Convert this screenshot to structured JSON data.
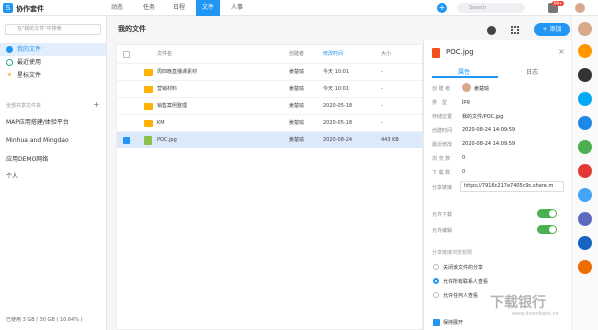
{
  "app": {
    "name": "协作套件",
    "logo_text": "S"
  },
  "nav": [
    "动态",
    "任务",
    "日程",
    "文件",
    "人事"
  ],
  "top": {
    "search_placeholder": "Search",
    "badge": "99+"
  },
  "sidebar": {
    "search_placeholder": "在\"我的文件\"中搜索",
    "items": [
      {
        "label": "我的文件"
      },
      {
        "label": "最近使用"
      },
      {
        "label": "星标文件"
      }
    ],
    "section_label": "全部共享文件夹",
    "shared": [
      "MAP应用搭建/体验平台",
      "Minhua and Mingdao",
      "应用DEMO网络",
      "个人"
    ],
    "footer": "已使用 3 GB / 30 GB ( 10.64% )"
  },
  "main": {
    "title": "我的文件",
    "add_label": "+ 添加",
    "headers": [
      "文件名",
      "创建者",
      "修改时间",
      "大小"
    ],
    "rows": [
      {
        "name": "周四晚直播课素材",
        "creator": "姜楚瑜",
        "time": "今天 10:01",
        "size": "-",
        "type": "folder"
      },
      {
        "name": "营销材料",
        "creator": "姜楚瑜",
        "time": "今天 10:01",
        "size": "-",
        "type": "folder"
      },
      {
        "name": "销售案例整理",
        "creator": "姜楚瑜",
        "time": "2020-05-18",
        "size": "-",
        "type": "folder"
      },
      {
        "name": "KM",
        "creator": "姜楚瑜",
        "time": "2020-05-18",
        "size": "-",
        "type": "folder"
      },
      {
        "name": "POC.jpg",
        "creator": "姜楚瑜",
        "time": "2020-08-24",
        "size": "443 KB",
        "type": "image"
      }
    ]
  },
  "panel": {
    "filename": "POC.jpg",
    "tabs": [
      "属性",
      "日志"
    ],
    "fields": [
      {
        "k": "创 建 者",
        "v": "姜楚瑜"
      },
      {
        "k": "类　型",
        "v": "jpg"
      },
      {
        "k": "存储位置",
        "v": "我的文件/POC.jpg"
      },
      {
        "k": "创建时间",
        "v": "2020-08-24 14:09:59"
      },
      {
        "k": "最近修改",
        "v": "2020-08-24 14:09:59"
      },
      {
        "k": "浏 览 数",
        "v": "0"
      },
      {
        "k": "下 载 数",
        "v": "0"
      },
      {
        "k": "分享链接",
        "v": "https://7916c217e7405c9c.share.m"
      }
    ],
    "allow_download": "允许下载",
    "allow_edit": "允许编辑",
    "share_section": "分享链接浏览权限",
    "radios": [
      "关闭该文件的分享",
      "允许所有联系人查看",
      "允许任何人查看"
    ],
    "footer_check": "保持展开"
  },
  "watermark": {
    "main": "下载银行",
    "sub": "www.downbank.cn"
  },
  "colors": {
    "accent": "#2196f3",
    "toggle": "#4caf50"
  }
}
